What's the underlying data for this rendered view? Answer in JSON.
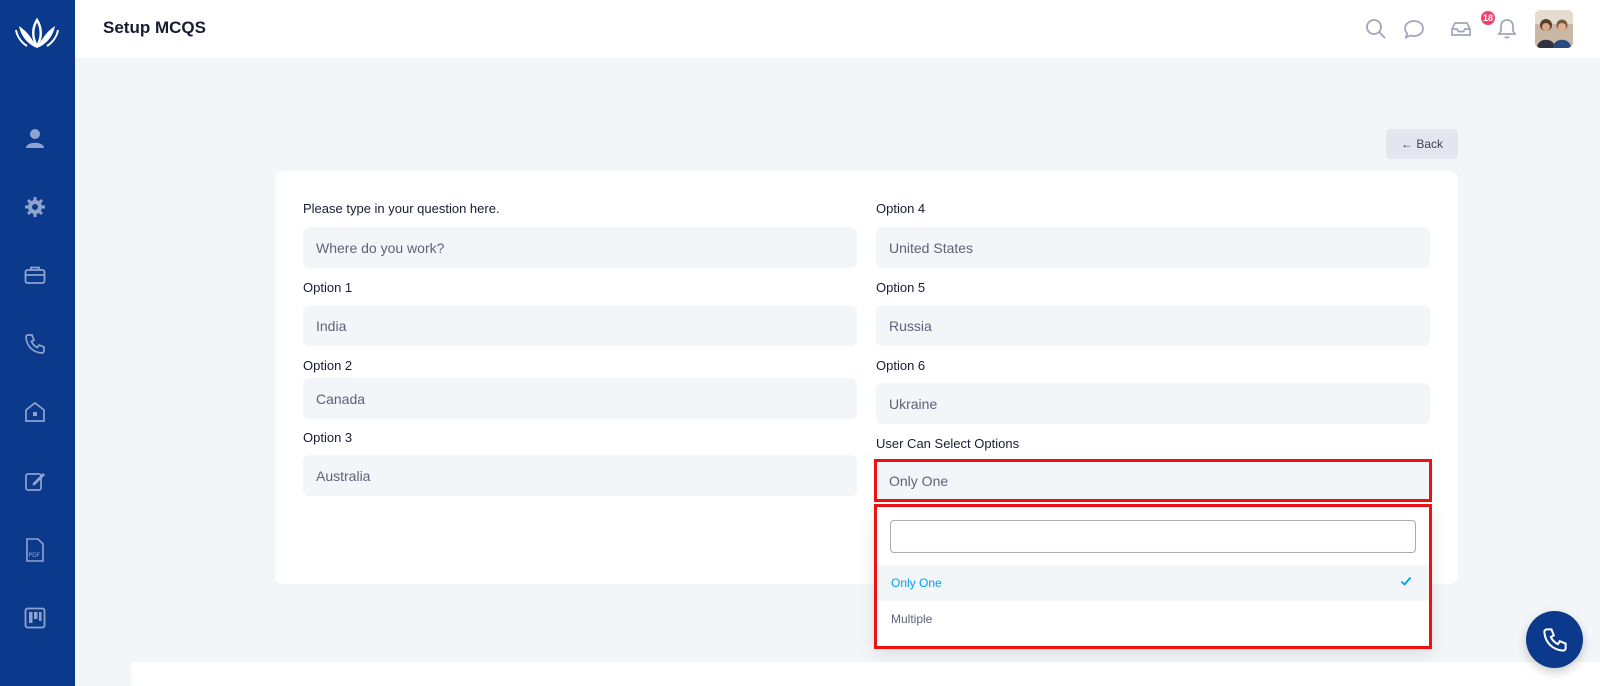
{
  "header": {
    "title": "Setup MCQS",
    "notification_count": "18"
  },
  "back_button": {
    "label": "← Back"
  },
  "form": {
    "question_label": "Please type in your question here.",
    "question_value": "Where do you work?",
    "option1_label": "Option 1",
    "option1_value": "India",
    "option2_label": "Option 2",
    "option2_value": "Canada",
    "option3_label": "Option 3",
    "option3_value": "Australia",
    "option4_label": "Option 4",
    "option4_value": "United States",
    "option5_label": "Option 5",
    "option5_value": "Russia",
    "option6_label": "Option 6",
    "option6_value": "Ukraine",
    "select_label": "User Can Select Options",
    "select_value": "Only One"
  },
  "dropdown": {
    "search_value": "",
    "options": [
      "Only One",
      "Multiple"
    ],
    "selected": "Only One"
  },
  "sidebar": {
    "items": [
      "user-icon",
      "gear-icon",
      "briefcase-icon",
      "phone-icon",
      "building-icon",
      "edit-icon",
      "pdf-icon",
      "board-icon"
    ]
  },
  "colors": {
    "sidebar": "#0b3a8c",
    "accent": "#009ef7",
    "highlight": "#ee1111",
    "badge": "#f1416c"
  }
}
